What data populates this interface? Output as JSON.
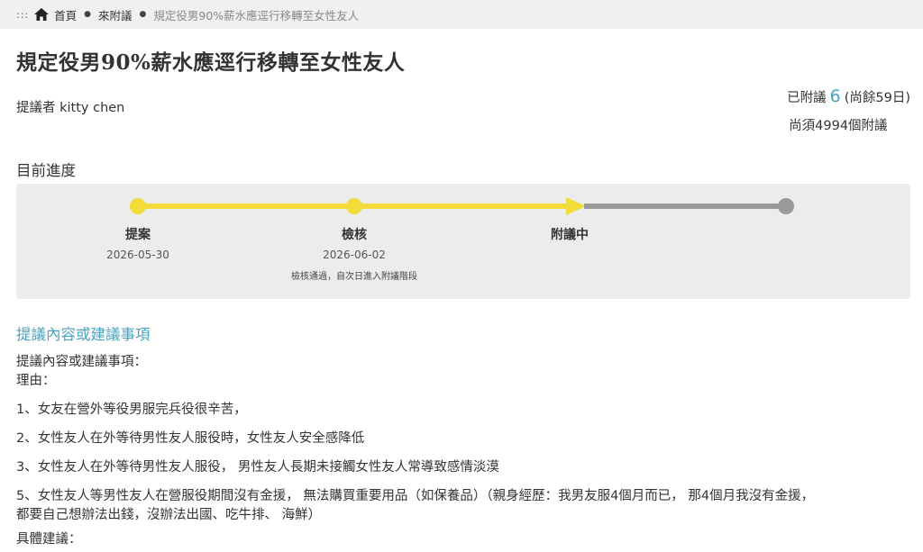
{
  "breadcrumb": {
    "dots": ":::",
    "home_label": "首頁",
    "section_label": "來附議",
    "current_label": "規定役男90%薪水應逕行移轉至女性友人",
    "separator": "●"
  },
  "petition": {
    "title": "規定役男90%薪水應逕行移轉至女性友人",
    "proposer": "提議者 kitty chen"
  },
  "stats": {
    "signed_prefix": "已附議",
    "signed_count": "6",
    "remaining_days": "(尚餘59日)",
    "needed": "尚須4994個附議"
  },
  "progress": {
    "heading": "目前進度",
    "stages": [
      {
        "label": "提案",
        "date": "2026-05-30",
        "note": ""
      },
      {
        "label": "檢核",
        "date": "2026-06-02",
        "note": "檢核通過，自次日進入附議階段"
      },
      {
        "label": "附議中",
        "date": "",
        "note": ""
      },
      {
        "label": "",
        "date": "",
        "note": ""
      }
    ],
    "active_color": "#f3dc3a",
    "inactive_color": "#9a9a9a"
  },
  "content": {
    "heading": "提議內容或建議事項",
    "lines": [
      "提議內容或建議事項：",
      "理由：",
      "1、女友在營外等役男服完兵役很辛苦，",
      "2、女性友人在外等待男性友人服役時，女性友人安全感降低",
      "3、女性友人在外等待男性友人服役， 男性友人長期未接觸女性友人常導致感情淡漠",
      "5、女性友人等男性友人在營服役期間沒有金援， 無法購買重要用品（如保養品）（親身經歷：我男友服4個月而已， 那4個月我沒有金援，",
      "都要自己想辦法出錢，沒辦法出國、吃牛排、 海鮮）",
      "具體建議："
    ]
  },
  "colors": {
    "accent": "#4aa3c0",
    "breadcrumb_bg": "#f0f0f0",
    "progress_bg": "#ececec"
  },
  "icons": {
    "home": "home-icon"
  }
}
